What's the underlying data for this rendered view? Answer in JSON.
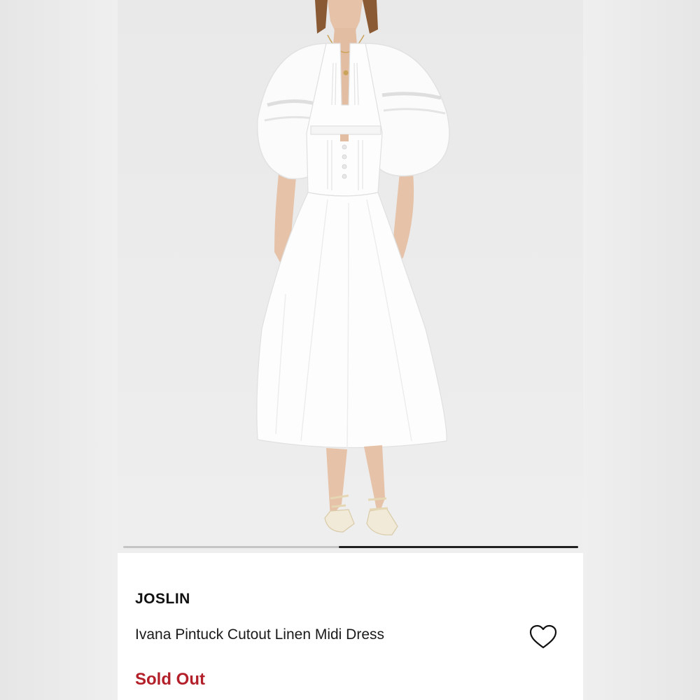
{
  "product": {
    "brand": "JOSLIN",
    "name": "Ivana Pintuck Cutout Linen Midi Dress",
    "status": "Sold Out"
  },
  "icons": {
    "wishlist": "heart-outline-icon"
  },
  "gallery": {
    "carousel_progress": 0.5
  },
  "colors": {
    "status": "#b3202a",
    "text": "#111111",
    "background": "#ffffff"
  }
}
